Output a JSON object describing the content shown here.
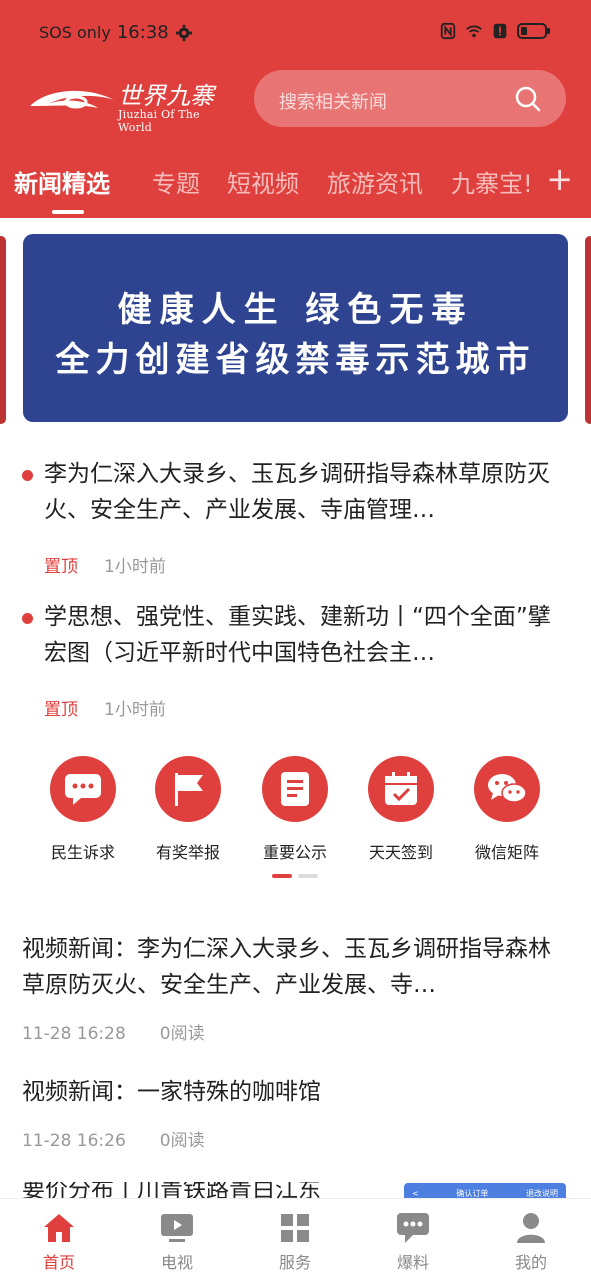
{
  "status_bar": {
    "carrier": "SOS only",
    "time": "16:38"
  },
  "header": {
    "logo_en": "Jiuzhai Of The World",
    "search_placeholder": "搜索相关新闻"
  },
  "tabs": [
    {
      "label": "新闻精选",
      "active": true
    },
    {
      "label": "专题"
    },
    {
      "label": "短视频"
    },
    {
      "label": "旅游资讯"
    },
    {
      "label": "九寨宝!"
    }
  ],
  "banner": {
    "line1": "健康人生  绿色无毒",
    "line2": "全力创建省级禁毒示范城市"
  },
  "pinned_news": [
    {
      "title": "李为仁深入大录乡、玉瓦乡调研指导森林草原防灭火、安全生产、产业发展、寺庙管理…",
      "tag": "置顶",
      "time": "1小时前"
    },
    {
      "title": "学思想、强党性、重实践、建新功丨“四个全面”擘宏图（习近平新时代中国特色社会主…",
      "tag": "置顶",
      "time": "1小时前"
    }
  ],
  "services": [
    {
      "label": "民生诉求",
      "icon": "chat-bubble-icon"
    },
    {
      "label": "有奖举报",
      "icon": "flag-icon"
    },
    {
      "label": "重要公示",
      "icon": "document-icon"
    },
    {
      "label": "天天签到",
      "icon": "calendar-check-icon"
    },
    {
      "label": "微信矩阵",
      "icon": "wechat-icon"
    }
  ],
  "articles": [
    {
      "title": "视频新闻：李为仁深入大录乡、玉瓦乡调研指导森林草原防灭火、安全生产、产业发展、寺…",
      "date": "11-28 16:28",
      "reads": "0阅读"
    },
    {
      "title": "视频新闻：一家特殊的咖啡馆",
      "date": "11-28 16:26",
      "reads": "0阅读"
    },
    {
      "title": "要价分布丨川青铁路青白江东"
    }
  ],
  "thumb": {
    "left": "<",
    "center": "确认订单",
    "right": "退改说明"
  },
  "bottom_nav": [
    {
      "label": "首页",
      "active": true,
      "icon": "home-icon"
    },
    {
      "label": "电视",
      "icon": "tv-icon"
    },
    {
      "label": "服务",
      "icon": "grid-icon"
    },
    {
      "label": "爆料",
      "icon": "message-icon"
    },
    {
      "label": "我的",
      "icon": "user-icon"
    }
  ],
  "colors": {
    "brand_red": "#e0403d",
    "banner_blue": "#2e4491"
  }
}
